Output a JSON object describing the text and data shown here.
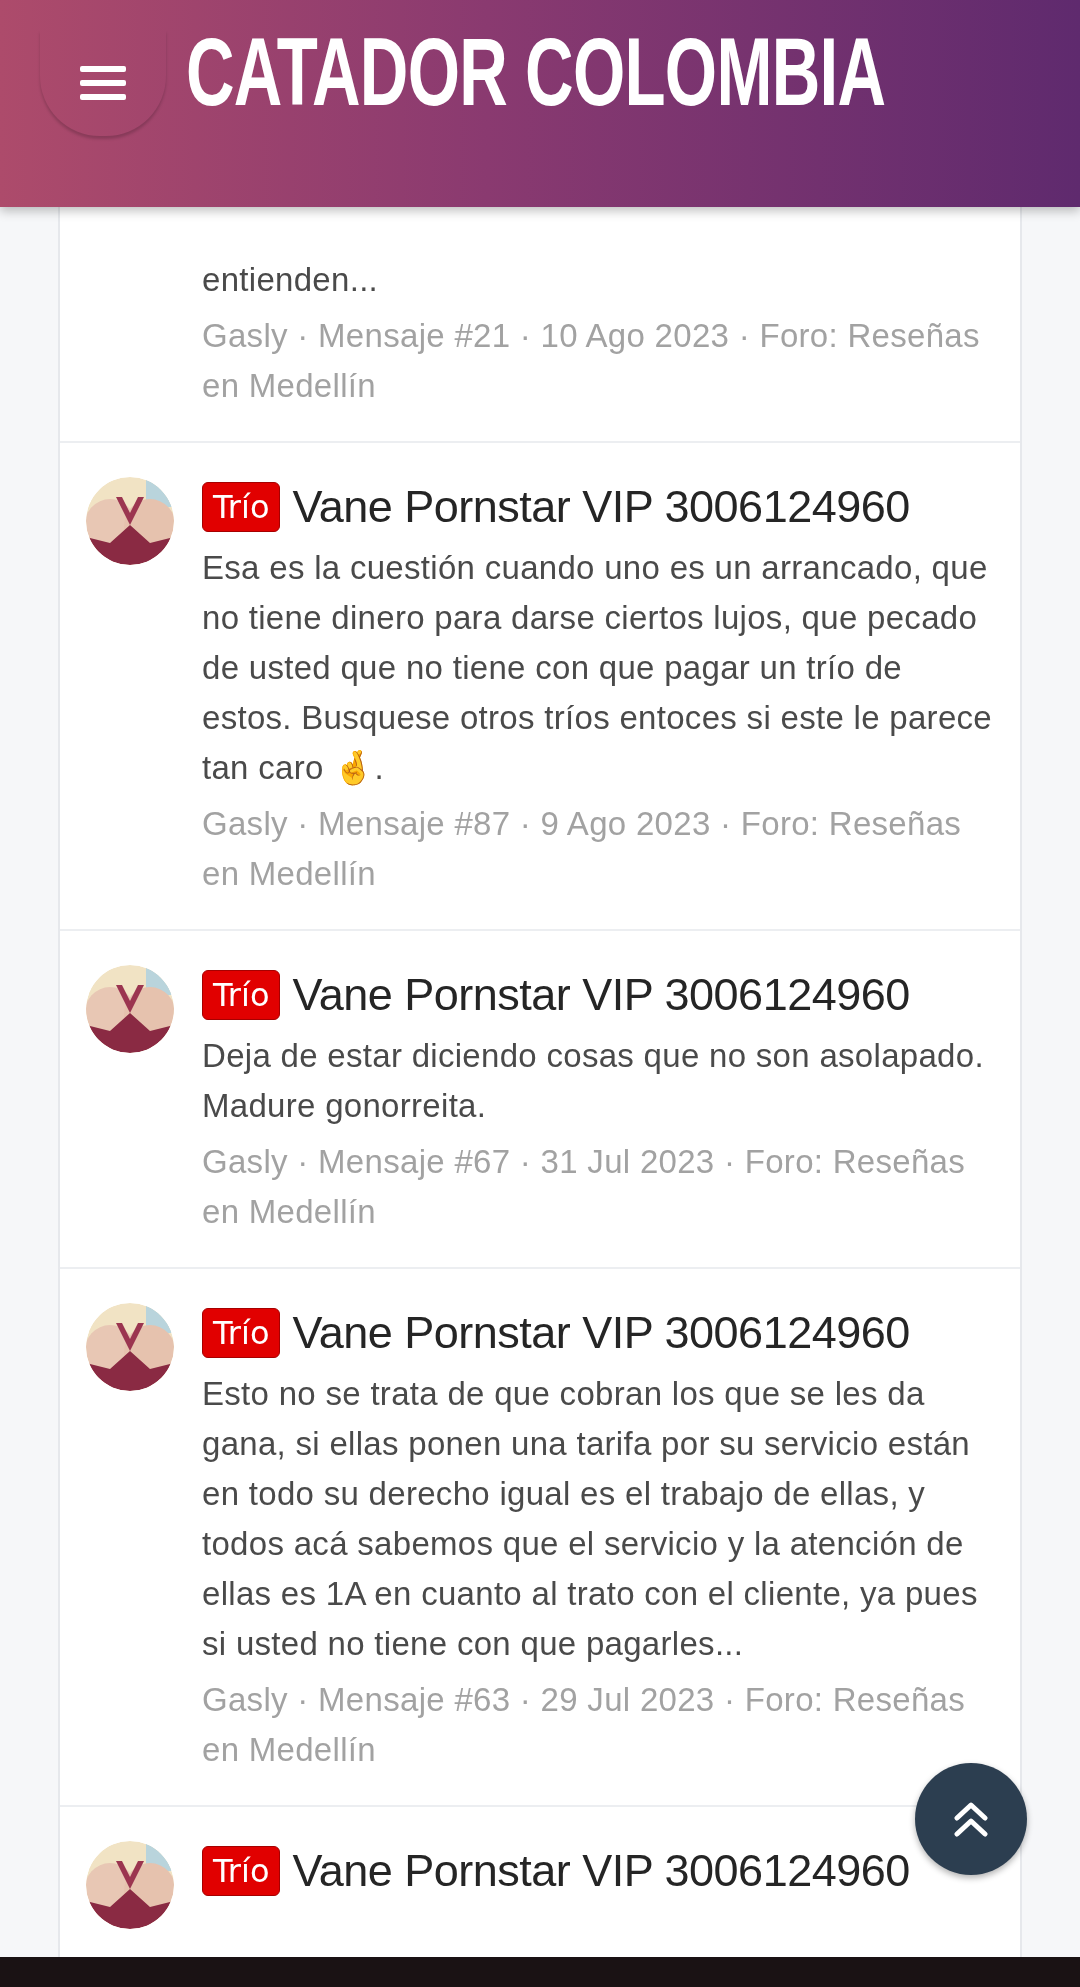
{
  "header": {
    "title": "CATADOR COLOMBIA"
  },
  "results": [
    {
      "kind": "cut",
      "snippet": "entienden...",
      "meta": "Gasly · Mensaje #21 · 10 Ago 2023 · Foro: Reseñas en Medellín"
    },
    {
      "kind": "full",
      "tag": "Trío",
      "title": "Vane Pornstar VIP 3006124960",
      "snippet": "Esa es la cuestión cuando uno es un arrancado, que no tiene dinero para darse ciertos lujos, que pecado de usted que no tiene con que pagar un trío de estos. Busquese otros tríos entoces si este le parece tan caro 🤞.",
      "meta": "Gasly · Mensaje #87 · 9 Ago 2023 · Foro: Reseñas en Medellín"
    },
    {
      "kind": "full",
      "tag": "Trío",
      "title": "Vane Pornstar VIP 3006124960",
      "snippet": "Deja de estar diciendo cosas que no son asolapado. Madure gonorreita.",
      "meta": "Gasly · Mensaje #67 · 31 Jul 2023 · Foro: Reseñas en Medellín"
    },
    {
      "kind": "full",
      "tag": "Trío",
      "title": "Vane Pornstar VIP 3006124960",
      "snippet": "Esto no se trata de que cobran los que se les da gana, si ellas ponen una tarifa por su servicio están en todo su derecho igual es el trabajo de ellas, y todos acá sabemos que el servicio y la atención de ellas es 1A en cuanto al trato con el cliente, ya pues si usted no tiene con que pagarles...",
      "meta": "Gasly · Mensaje #63 · 29 Jul 2023 · Foro: Reseñas en Medellín"
    },
    {
      "kind": "full",
      "tag": "Trío",
      "title": "Vane Pornstar VIP 3006124960"
    }
  ]
}
